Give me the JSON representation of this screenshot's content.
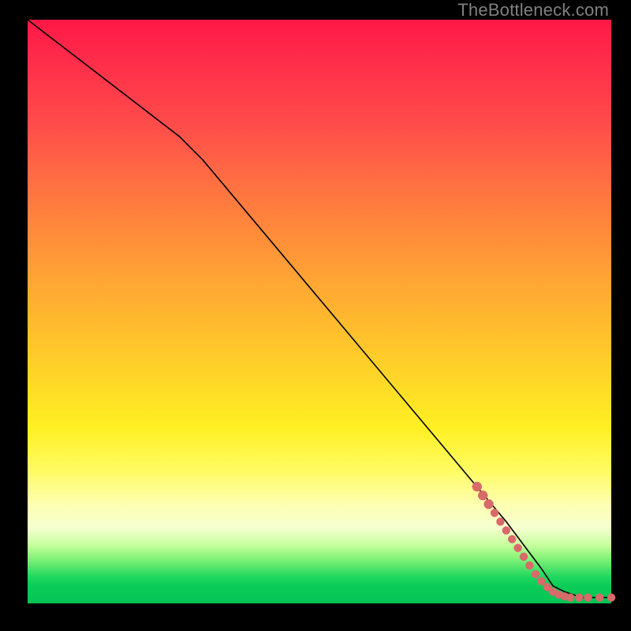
{
  "watermark": "TheBottleneck.com",
  "chart_data": {
    "type": "line",
    "title": "",
    "xlabel": "",
    "ylabel": "",
    "xlim": [
      0,
      100
    ],
    "ylim": [
      0,
      100
    ],
    "grid": false,
    "series": [
      {
        "name": "curve",
        "points": [
          {
            "x": 0,
            "y": 100
          },
          {
            "x": 26,
            "y": 80
          },
          {
            "x": 28,
            "y": 78
          },
          {
            "x": 30,
            "y": 76
          },
          {
            "x": 82,
            "y": 14
          },
          {
            "x": 88,
            "y": 6
          },
          {
            "x": 90,
            "y": 3
          },
          {
            "x": 92,
            "y": 2
          },
          {
            "x": 95,
            "y": 1
          },
          {
            "x": 100,
            "y": 1
          }
        ]
      }
    ],
    "markers": [
      {
        "x": 77,
        "y": 20,
        "r": 6
      },
      {
        "x": 78,
        "y": 18.5,
        "r": 6
      },
      {
        "x": 79,
        "y": 17,
        "r": 6
      },
      {
        "x": 80,
        "y": 15.5,
        "r": 5
      },
      {
        "x": 81,
        "y": 14,
        "r": 5
      },
      {
        "x": 82,
        "y": 12.5,
        "r": 5
      },
      {
        "x": 83,
        "y": 11,
        "r": 5
      },
      {
        "x": 84,
        "y": 9.5,
        "r": 5
      },
      {
        "x": 85,
        "y": 8,
        "r": 5
      },
      {
        "x": 86,
        "y": 6.5,
        "r": 5
      },
      {
        "x": 87,
        "y": 5,
        "r": 5
      },
      {
        "x": 88,
        "y": 3.8,
        "r": 5
      },
      {
        "x": 89,
        "y": 2.8,
        "r": 5
      },
      {
        "x": 90,
        "y": 2.0,
        "r": 5
      },
      {
        "x": 91,
        "y": 1.5,
        "r": 5
      },
      {
        "x": 92,
        "y": 1.2,
        "r": 5
      },
      {
        "x": 93,
        "y": 1.0,
        "r": 5
      },
      {
        "x": 94.5,
        "y": 1.0,
        "r": 5
      },
      {
        "x": 96,
        "y": 1.0,
        "r": 5
      },
      {
        "x": 98,
        "y": 1.0,
        "r": 5
      },
      {
        "x": 100,
        "y": 1.0,
        "r": 5
      }
    ]
  }
}
